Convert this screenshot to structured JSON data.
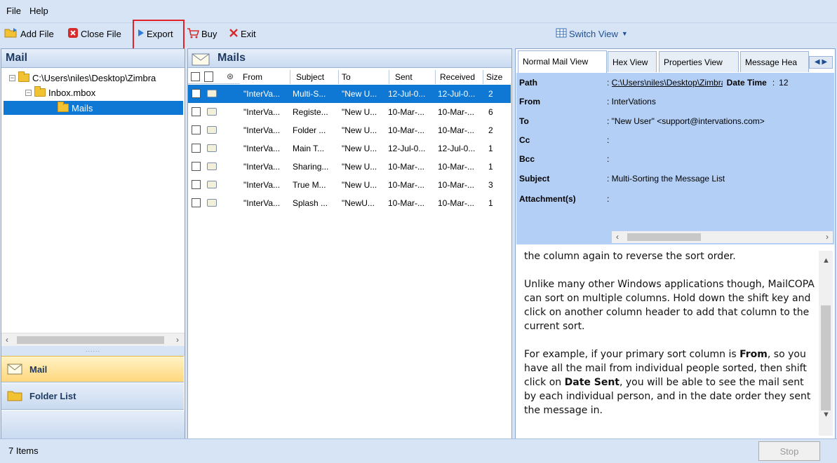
{
  "menu": {
    "file": "File",
    "help": "Help"
  },
  "toolbar": {
    "add_file": "Add File",
    "close_file": "Close File",
    "export": "Export",
    "buy": "Buy",
    "exit": "Exit",
    "switch_view": "Switch View"
  },
  "left_pane": {
    "title": "Mail",
    "tree": {
      "root": "C:\\Users\\niles\\Desktop\\Zimbra",
      "child": "Inbox.mbox",
      "leaf": "Mails"
    },
    "grip": "......",
    "nav": {
      "mail": "Mail",
      "folder_list": "Folder List"
    }
  },
  "middle_pane": {
    "title": "Mails",
    "columns": [
      "From",
      "Subject",
      "To",
      "Sent",
      "Received",
      "Size"
    ],
    "rows": [
      {
        "from": "\"InterVa...",
        "subject": "Multi-S...",
        "to": "\"New U...",
        "sent": "12-Jul-0...",
        "received": "12-Jul-0...",
        "size": "2"
      },
      {
        "from": "\"InterVa...",
        "subject": "Registe...",
        "to": "\"New U...",
        "sent": "10-Mar-...",
        "received": "10-Mar-...",
        "size": "6"
      },
      {
        "from": "\"InterVa...",
        "subject": "Folder ...",
        "to": "\"New U...",
        "sent": "10-Mar-...",
        "received": "10-Mar-...",
        "size": "2"
      },
      {
        "from": "\"InterVa...",
        "subject": "Main T...",
        "to": "\"New U...",
        "sent": "12-Jul-0...",
        "received": "12-Jul-0...",
        "size": "1"
      },
      {
        "from": "\"InterVa...",
        "subject": "Sharing...",
        "to": "\"New U...",
        "sent": "10-Mar-...",
        "received": "10-Mar-...",
        "size": "1"
      },
      {
        "from": "\"InterVa...",
        "subject": "True M...",
        "to": "\"New U...",
        "sent": "10-Mar-...",
        "received": "10-Mar-...",
        "size": "3"
      },
      {
        "from": "\"InterVa...",
        "subject": "Splash ...",
        "to": "\"NewU...",
        "sent": "10-Mar-...",
        "received": "10-Mar-...",
        "size": "1"
      }
    ]
  },
  "right_pane": {
    "tabs": [
      "Normal Mail View",
      "Hex View",
      "Properties View",
      "Message Hea"
    ],
    "props": {
      "path_label": "Path",
      "path_value": "C:\\Users\\niles\\Desktop\\Zimbra",
      "datetime_label": "Date Time",
      "datetime_sep": ":",
      "datetime_value": "12",
      "from_label": "From",
      "from_value": ": InterVations",
      "to_label": "To",
      "to_value": ": \"New User\" <support@intervations.com>",
      "cc_label": "Cc",
      "cc_value": ":",
      "bcc_label": "Bcc",
      "bcc_value": ":",
      "subject_label": "Subject",
      "subject_value": ": Multi-Sorting the Message List",
      "attach_label": "Attachment(s)",
      "attach_value": ":"
    },
    "body": {
      "p0": "the column again to reverse the sort order.",
      "p1": "Unlike many other Windows applications though, MailCOPA can sort on multiple columns.  Hold down the shift key and click on another column header to add that column to the current sort.",
      "p2a": "For example, if your primary sort column is ",
      "p2b": "From",
      "p2c": ", so you have all the mail from individual people sorted, then shift click on ",
      "p2d": "Date Sent",
      "p2e": ", you will be able to see the mail sent by each individual person, and in the date order they sent the message in."
    }
  },
  "status": {
    "items": "7 Items",
    "stop": "Stop"
  },
  "colors": {
    "accent": "#0e78d4",
    "panel": "#d6e4f5",
    "highlight_box": "#e0232b"
  }
}
